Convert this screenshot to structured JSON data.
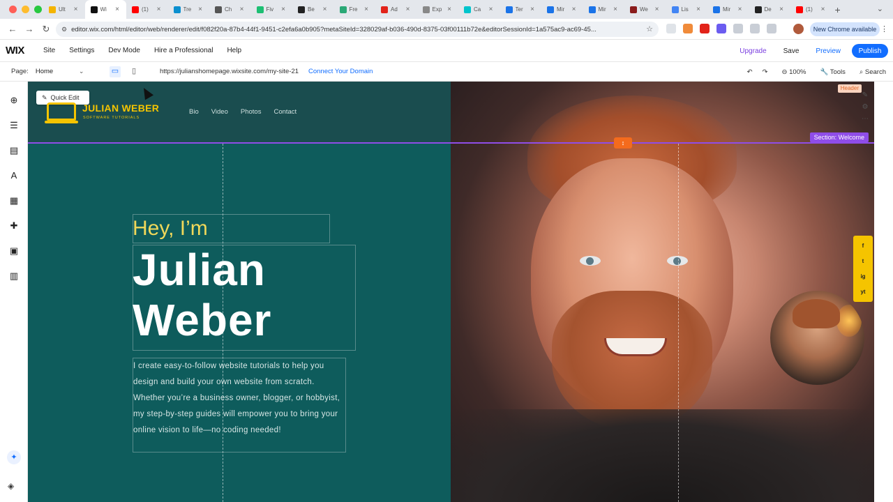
{
  "browser": {
    "tabs": [
      {
        "title": "Ult",
        "favicon_color": "#f4b400"
      },
      {
        "title": "Wi",
        "favicon_color": "#111111",
        "active": true
      },
      {
        "title": "(1)",
        "favicon_color": "#ff0000"
      },
      {
        "title": "Tre",
        "favicon_color": "#0b8fcf"
      },
      {
        "title": "Ch",
        "favicon_color": "#555555"
      },
      {
        "title": "Fiv",
        "favicon_color": "#1dbf73"
      },
      {
        "title": "Be",
        "favicon_color": "#222222"
      },
      {
        "title": "Fre",
        "favicon_color": "#2aa876"
      },
      {
        "title": "Ad",
        "favicon_color": "#e2231a"
      },
      {
        "title": "Exp",
        "favicon_color": "#888888"
      },
      {
        "title": "Ca",
        "favicon_color": "#00c4cc"
      },
      {
        "title": "Ter",
        "favicon_color": "#1a73e8"
      },
      {
        "title": "Mir",
        "favicon_color": "#1a73e8"
      },
      {
        "title": "Mir",
        "favicon_color": "#1a73e8"
      },
      {
        "title": "We",
        "favicon_color": "#8a1c1c"
      },
      {
        "title": "Lis",
        "favicon_color": "#4285f4"
      },
      {
        "title": "Mir",
        "favicon_color": "#1a73e8"
      },
      {
        "title": "De",
        "favicon_color": "#222222"
      },
      {
        "title": "(1)",
        "favicon_color": "#ff0000"
      }
    ],
    "url": "editor.wix.com/html/editor/web/renderer/edit/f082f20a-87b4-44f1-9451-c2efa6a0b905?metaSiteId=328029af-b036-490d-8375-03f00111b72e&editorSessionId=1a575ac9-ac69-45...",
    "update_label": "New Chrome available"
  },
  "wix": {
    "logo": "WIX",
    "menu": [
      "Site",
      "Settings",
      "Dev Mode",
      "Hire a Professional",
      "Help"
    ],
    "upgrade": "Upgrade",
    "save": "Save",
    "preview": "Preview",
    "publish": "Publish",
    "page_label": "Page:",
    "page_value": "Home",
    "site_url": "https://julianshomepage.wixsite.com/my-site-21",
    "connect_domain": "Connect Your Domain",
    "zoom": "100%",
    "tools": "Tools",
    "search": "Search",
    "quick_edit": "Quick Edit",
    "header_tag": "Header",
    "section_label": "Section: Welcome"
  },
  "site": {
    "logo_name": "JULIAN WEBER",
    "logo_tagline": "SOFTWARE TUTORIALS",
    "nav": [
      "Bio",
      "Video",
      "Photos",
      "Contact"
    ],
    "greeting": "Hey, I’m",
    "name_line1": "Julian",
    "name_line2": "Weber",
    "bio": "I create easy-to-follow website tutorials to help you design and build your own website from scratch. Whether you’re a business owner, blogger, or hobbyist, my step-by-step guides will empower you to bring your online vision to life—no coding needed!",
    "social": [
      "f",
      "t",
      "ig",
      "yt"
    ]
  },
  "colors": {
    "accent_blue": "#116dff",
    "upgrade_purple": "#7a3ee0",
    "section_purple": "#8f4de8",
    "site_teal": "#0e5c5c",
    "logo_yellow": "#f5c400"
  }
}
